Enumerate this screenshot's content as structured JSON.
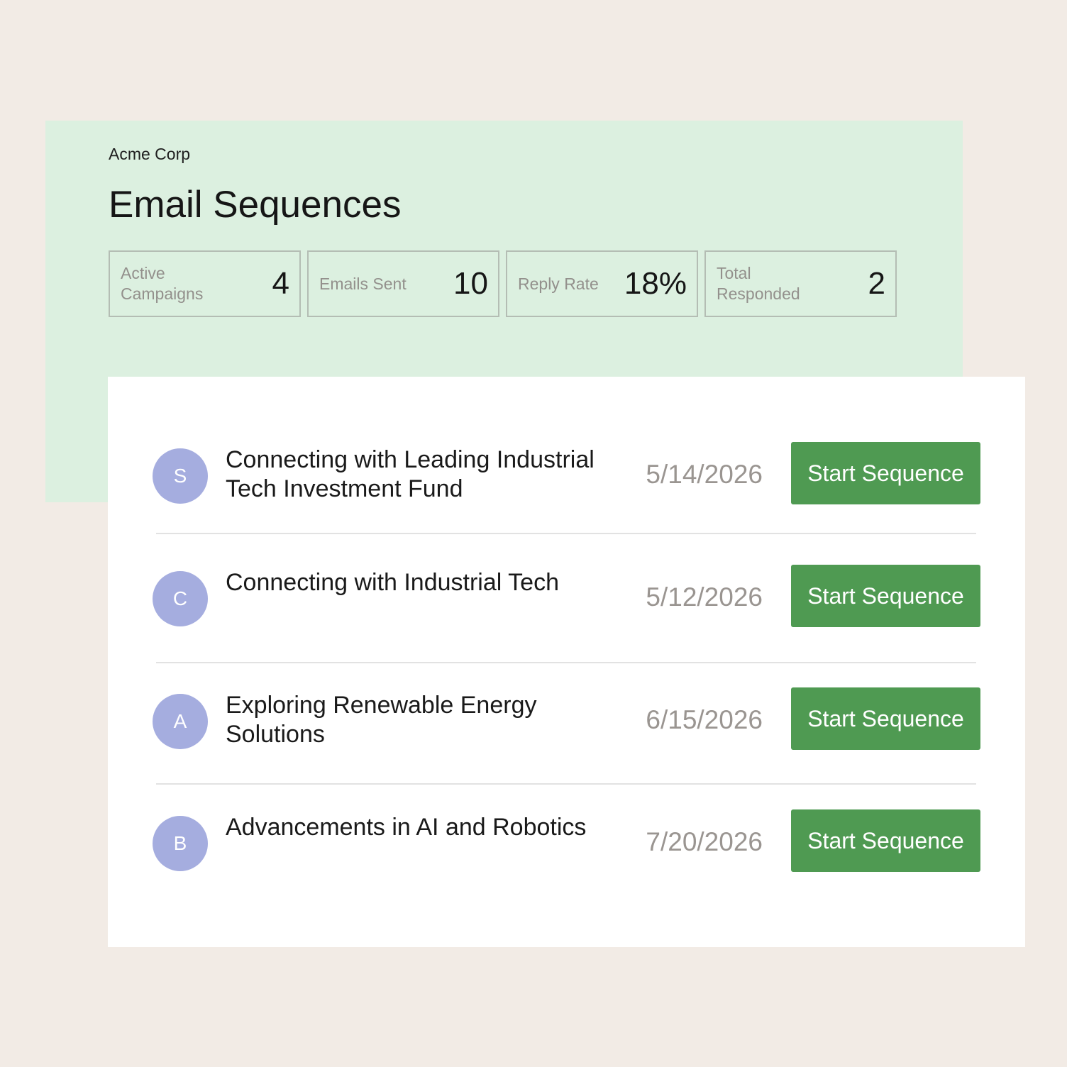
{
  "header": {
    "company": "Acme Corp",
    "title": "Email Sequences"
  },
  "stats": [
    {
      "label": "Active Campaigns",
      "value": "4"
    },
    {
      "label": "Emails Sent",
      "value": "10"
    },
    {
      "label": "Reply Rate",
      "value": "18%"
    },
    {
      "label": "Total Responded",
      "value": "2"
    }
  ],
  "sequences": [
    {
      "initial": "S",
      "title": "Connecting with Leading Industrial Tech Investment Fund",
      "date": "5/14/2026",
      "action": "Start Sequence"
    },
    {
      "initial": "C",
      "title": "Connecting with Industrial Tech",
      "date": "5/12/2026",
      "action": "Start Sequence"
    },
    {
      "initial": "A",
      "title": "Exploring Renewable Energy Solutions",
      "date": "6/15/2026",
      "action": "Start Sequence"
    },
    {
      "initial": "B",
      "title": "Advancements in AI and Robotics",
      "date": "7/20/2026",
      "action": "Start Sequence"
    }
  ],
  "colors": {
    "background": "#f2ebe5",
    "header_panel": "#dcf0e0",
    "avatar": "#a5addf",
    "button": "#4f9a52"
  }
}
